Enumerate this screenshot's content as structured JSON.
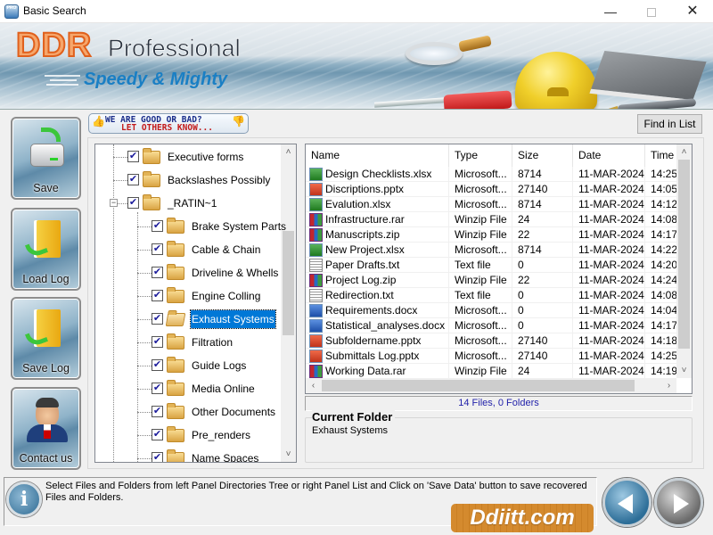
{
  "window": {
    "title": "Basic Search",
    "app_icon_text": "PRO",
    "minimize": "—",
    "close": "✕"
  },
  "banner": {
    "brand": "DDR",
    "product": "Professional",
    "tagline": "Speedy & Mighty"
  },
  "sidebar": {
    "buttons": [
      {
        "label": "Save",
        "icon": "save-drive-icon"
      },
      {
        "label": "Load Log",
        "icon": "load-log-folder-icon"
      },
      {
        "label": "Save Log",
        "icon": "save-log-folder-icon"
      },
      {
        "label": "Contact us",
        "icon": "contact-person-icon"
      }
    ]
  },
  "feedback": {
    "line1": "WE ARE GOOD OR BAD?",
    "line2": "LET OTHERS KNOW...",
    "thumb_up": "👍",
    "thumb_down": "👎"
  },
  "toolbar": {
    "find_label": "Find in List"
  },
  "tree": {
    "items": [
      {
        "label": "Executive forms",
        "level": 1,
        "checked": true
      },
      {
        "label": "Backslashes Possibly",
        "level": 1,
        "checked": true
      },
      {
        "label": "_RATIN~1",
        "level": 1,
        "checked": true,
        "expanded": true
      },
      {
        "label": "Brake System Parts",
        "level": 2,
        "checked": true
      },
      {
        "label": "Cable & Chain",
        "level": 2,
        "checked": true
      },
      {
        "label": "Driveline & Whells",
        "level": 2,
        "checked": true
      },
      {
        "label": "Engine Colling",
        "level": 2,
        "checked": true
      },
      {
        "label": "Exhaust Systems",
        "level": 2,
        "checked": true,
        "selected": true
      },
      {
        "label": "Filtration",
        "level": 2,
        "checked": true
      },
      {
        "label": "Guide Logs",
        "level": 2,
        "checked": true
      },
      {
        "label": "Media Online",
        "level": 2,
        "checked": true
      },
      {
        "label": "Other Documents",
        "level": 2,
        "checked": true
      },
      {
        "label": "Pre_renders",
        "level": 2,
        "checked": true
      },
      {
        "label": "Name Spaces",
        "level": 2,
        "checked": true
      }
    ],
    "check_mark": "✔",
    "collapse_symbol": "−"
  },
  "file_list": {
    "columns": [
      "Name",
      "Type",
      "Size",
      "Date",
      "Time"
    ],
    "rows": [
      {
        "name": "Design Checklists.xlsx",
        "type": "Microsoft...",
        "size": "8714",
        "date": "11-MAR-2024",
        "time": "14:25",
        "kind": "xlsx"
      },
      {
        "name": "Discriptions.pptx",
        "type": "Microsoft...",
        "size": "27140",
        "date": "11-MAR-2024",
        "time": "14:05",
        "kind": "pptx"
      },
      {
        "name": "Evalution.xlsx",
        "type": "Microsoft...",
        "size": "8714",
        "date": "11-MAR-2024",
        "time": "14:12",
        "kind": "xlsx"
      },
      {
        "name": "Infrastructure.rar",
        "type": "Winzip File",
        "size": "24",
        "date": "11-MAR-2024",
        "time": "14:08",
        "kind": "zip"
      },
      {
        "name": "Manuscripts.zip",
        "type": "Winzip File",
        "size": "22",
        "date": "11-MAR-2024",
        "time": "14:17",
        "kind": "zip"
      },
      {
        "name": "New Project.xlsx",
        "type": "Microsoft...",
        "size": "8714",
        "date": "11-MAR-2024",
        "time": "14:22",
        "kind": "xlsx"
      },
      {
        "name": "Paper Drafts.txt",
        "type": "Text file",
        "size": "0",
        "date": "11-MAR-2024",
        "time": "14:20",
        "kind": "txt"
      },
      {
        "name": "Project Log.zip",
        "type": "Winzip File",
        "size": "22",
        "date": "11-MAR-2024",
        "time": "14:24",
        "kind": "zip"
      },
      {
        "name": "Redirection.txt",
        "type": "Text file",
        "size": "0",
        "date": "11-MAR-2024",
        "time": "14:08",
        "kind": "txt"
      },
      {
        "name": "Requirements.docx",
        "type": "Microsoft...",
        "size": "0",
        "date": "11-MAR-2024",
        "time": "14:04",
        "kind": "docx"
      },
      {
        "name": "Statistical_analyses.docx",
        "type": "Microsoft...",
        "size": "0",
        "date": "11-MAR-2024",
        "time": "14:17",
        "kind": "docx"
      },
      {
        "name": "Subfoldername.pptx",
        "type": "Microsoft...",
        "size": "27140",
        "date": "11-MAR-2024",
        "time": "14:18",
        "kind": "pptx"
      },
      {
        "name": "Submittals Log.pptx",
        "type": "Microsoft...",
        "size": "27140",
        "date": "11-MAR-2024",
        "time": "14:25",
        "kind": "pptx"
      },
      {
        "name": "Working Data.rar",
        "type": "Winzip File",
        "size": "24",
        "date": "11-MAR-2024",
        "time": "14:19",
        "kind": "zip"
      }
    ],
    "count_text": "14 Files, 0 Folders"
  },
  "current_folder": {
    "title": "Current Folder",
    "value": "Exhaust Systems"
  },
  "info": {
    "icon": "i",
    "text": "Select Files and Folders from left Panel Directories Tree or right Panel List and Click on 'Save Data' button to save recovered Files and Folders."
  },
  "watermark": "Ddiitt.com",
  "scroll_arrows": {
    "up": "˄",
    "down": "˅",
    "left": "‹",
    "right": "›"
  }
}
